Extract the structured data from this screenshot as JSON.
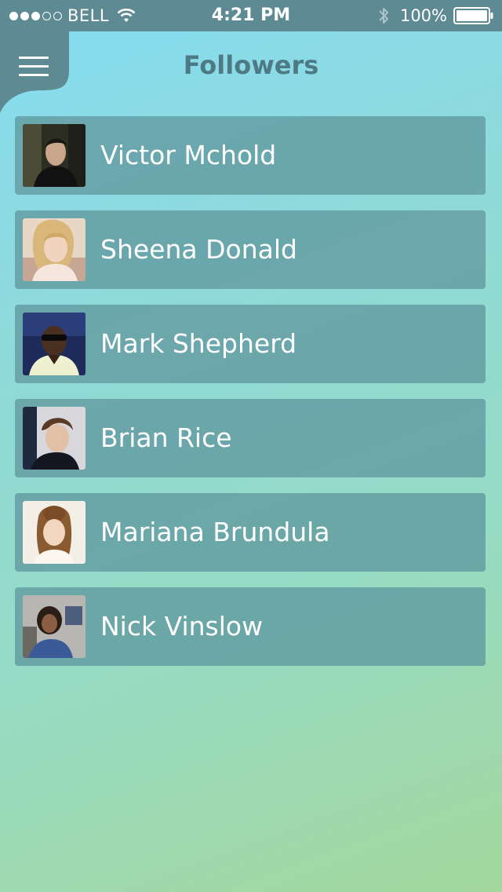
{
  "status_bar": {
    "carrier": "BELL",
    "time": "4:21 PM",
    "battery": "100%",
    "signal_bars_filled": 3,
    "signal_bars_total": 5
  },
  "header": {
    "title": "Followers",
    "menu_icon": "hamburger-icon"
  },
  "followers": [
    {
      "name": "Victor Mchold"
    },
    {
      "name": "Sheena Donald"
    },
    {
      "name": "Mark Shepherd"
    },
    {
      "name": "Brian Rice"
    },
    {
      "name": "Mariana Brundula"
    },
    {
      "name": "Nick Vinslow"
    }
  ],
  "colors": {
    "status_bar": "#5d8a93",
    "title": "#4e7a85",
    "card": "#629aa0",
    "gradient_top": "#86dcf2",
    "gradient_bottom": "#a3d79c"
  }
}
